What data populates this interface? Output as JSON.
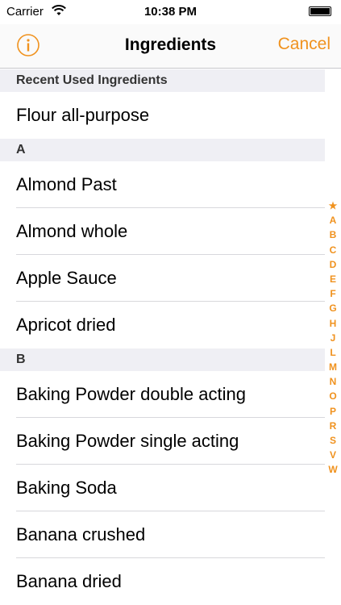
{
  "status_bar": {
    "carrier": "Carrier",
    "time": "10:38 PM"
  },
  "nav": {
    "title": "Ingredients",
    "cancel_label": "Cancel"
  },
  "sections": [
    {
      "header": "Recent Used Ingredients",
      "items": [
        "Flour all-purpose"
      ]
    },
    {
      "header": "A",
      "items": [
        "Almond Past",
        "Almond whole",
        "Apple Sauce",
        "Apricot dried"
      ]
    },
    {
      "header": "B",
      "items": [
        "Baking Powder double acting",
        "Baking Powder single acting",
        "Baking Soda",
        "Banana crushed",
        "Banana dried"
      ]
    }
  ],
  "index": [
    "★",
    "A",
    "B",
    "C",
    "D",
    "E",
    "F",
    "G",
    "H",
    "J",
    "L",
    "M",
    "N",
    "O",
    "P",
    "R",
    "S",
    "V",
    "W"
  ],
  "colors": {
    "accent": "#f0921e",
    "section_bg": "#efeff4"
  }
}
